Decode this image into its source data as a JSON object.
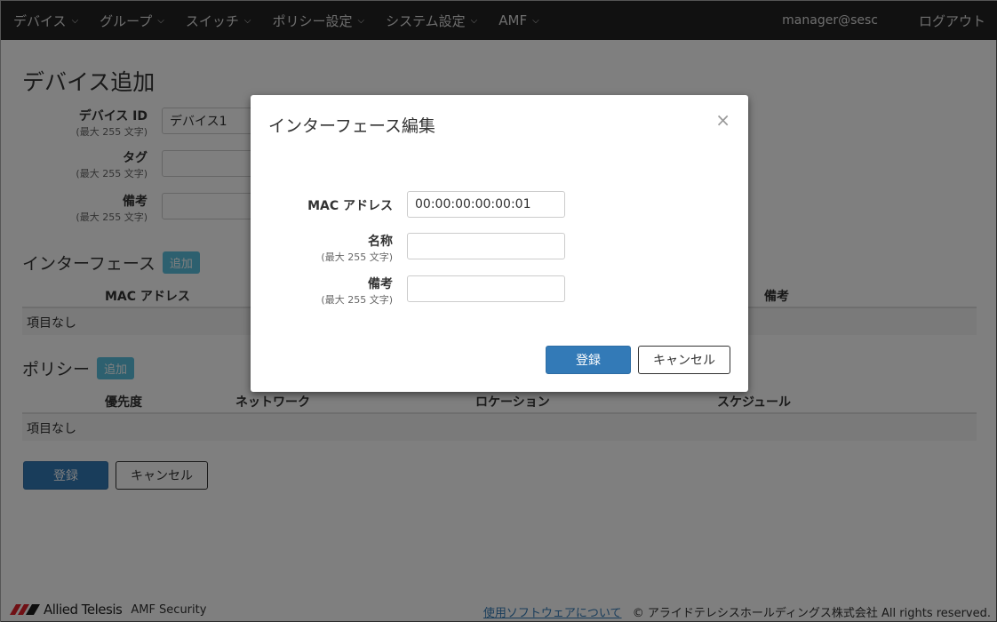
{
  "navbar": {
    "items": [
      "デバイス",
      "グループ",
      "スイッチ",
      "ポリシー設定",
      "システム設定",
      "AMF"
    ],
    "user": "manager@sesc",
    "logout": "ログアウト"
  },
  "page": {
    "title": "デバイス追加",
    "fields": {
      "device_id": {
        "label": "デバイス ID",
        "sub": "(最大 255 文字)",
        "value": "デバイス1"
      },
      "tag": {
        "label": "タグ",
        "sub": "(最大 255 文字)",
        "value": ""
      },
      "note": {
        "label": "備考",
        "sub": "(最大 255 文字)",
        "value": ""
      }
    },
    "interface_section": {
      "title": "インターフェース",
      "add": "追加",
      "columns": [
        "MAC アドレス",
        "備考"
      ],
      "empty": "項目なし"
    },
    "policy_section": {
      "title": "ポリシー",
      "add": "追加",
      "columns": [
        "優先度",
        "ネットワーク",
        "ロケーション",
        "スケジュール"
      ],
      "empty": "項目なし"
    },
    "register": "登録",
    "cancel": "キャンセル"
  },
  "modal": {
    "title": "インターフェース編集",
    "close": "×",
    "mac": {
      "label": "MAC アドレス",
      "value": "00:00:00:00:00:01"
    },
    "name": {
      "label": "名称",
      "sub": "(最大 255 文字)",
      "value": ""
    },
    "note": {
      "label": "備考",
      "sub": "(最大 255 文字)",
      "value": ""
    },
    "register": "登録",
    "cancel": "キャンセル"
  },
  "footer": {
    "brand": "Allied Telesis",
    "product": "AMF Security",
    "link": "使用ソフトウェアについて",
    "copyright": "© アライドテレシスホールディングス株式会社 All rights reserved.",
    "brand_color": "#e0202a"
  }
}
